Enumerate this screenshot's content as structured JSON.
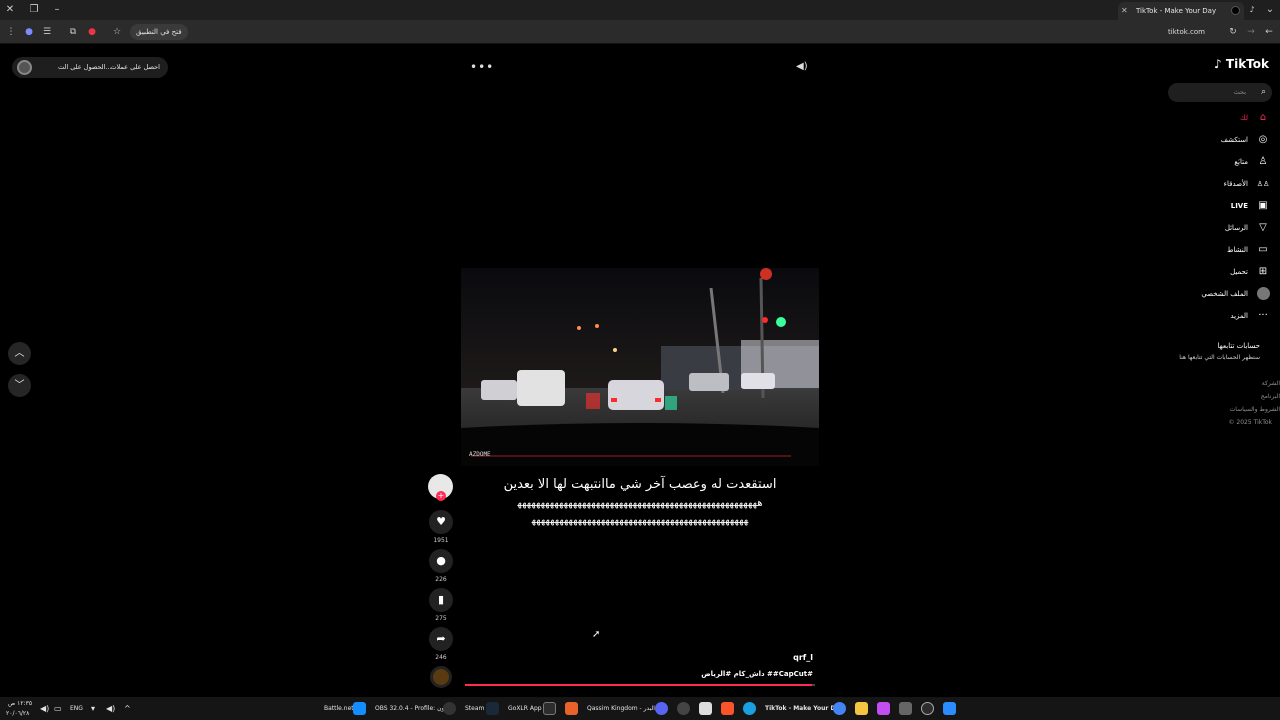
{
  "browser": {
    "tab_title": "TikTok - Make Your Day",
    "url": "tiktok.com",
    "open_in_app": "فتح في التطبيق"
  },
  "topbar": {
    "get_coins": "احصل على عملات",
    "get_access": "الحصول على الت..."
  },
  "video": {
    "caption_line1": "استقعدت له وعصب آخر شي ماانتبهت لها الا بعدين",
    "caption_line2": "ﻫﻬﻬﻬﻬﻬﻬﻬﻬﻬﻬﻬﻬﻬﻬﻬﻬﻬﻬﻬﻬﻬﻬﻬﻬﻬﻬﻬﻬﻬﻬﻬﻬﻬﻬﻬﻬﻬﻬﻬﻬﻬﻬﻬﻬﻬﻬﻬﻬﻬﻬﻬﻬ",
    "caption_line3": "ﻬﻬﻬﻬﻬﻬﻬﻬﻬﻬﻬﻬﻬﻬﻬﻬﻬﻬﻬﻬﻬﻬﻬﻬﻬﻬﻬﻬﻬﻬﻬﻬﻬﻬﻬﻬﻬﻬﻬﻬﻬﻬﻬﻬﻬﻬﻬ",
    "username": "qrf_l",
    "hashtags": "#CapCut## داش_كام #الرياض",
    "dashcam_stamp": "AZDOME",
    "progress": 0.99
  },
  "actions": {
    "likes": "1951",
    "comments": "226",
    "saves": "275",
    "shares": "246"
  },
  "sidebar": {
    "logo": "TikTok",
    "search_placeholder": "بحث",
    "nav": [
      {
        "label": "لك",
        "icon": "home-icon",
        "active": true
      },
      {
        "label": "استكشف",
        "icon": "compass-icon",
        "active": false
      },
      {
        "label": "متابَع",
        "icon": "user-follow-icon",
        "active": false
      },
      {
        "label": "الأصدقاء",
        "icon": "friends-icon",
        "active": false
      },
      {
        "label": "LIVE",
        "icon": "live-icon",
        "active": false
      },
      {
        "label": "الرسائل",
        "icon": "send-icon",
        "active": false
      },
      {
        "label": "النشاط",
        "icon": "inbox-icon",
        "active": false
      },
      {
        "label": "تحميل",
        "icon": "upload-icon",
        "active": false
      },
      {
        "label": "الملف الشخصي",
        "icon": "profile-avatar",
        "active": false
      },
      {
        "label": "المزيد",
        "icon": "more-icon",
        "active": false
      }
    ],
    "following_title": "حسابات تتابعها",
    "following_sub": "ستظهر الحسابات التي تتابعها هنا",
    "footer": [
      "الشركة",
      "البرنامج",
      "الشروط والسياسات",
      "© 2025 TikTok"
    ]
  },
  "taskbar": {
    "time": "١٢:٣٥ ص",
    "date": "٢٠/٠٦/٢٨",
    "lang": "ENG",
    "apps": [
      "Battle.net",
      "OBS 32.0.4 - Profile: بدون",
      "Steam",
      "GoXLR App",
      "Qassim Kingdom - البدر",
      "TikTok - Make Your Day"
    ]
  },
  "colors": {
    "accent": "#fe2c55",
    "background": "#000000"
  }
}
